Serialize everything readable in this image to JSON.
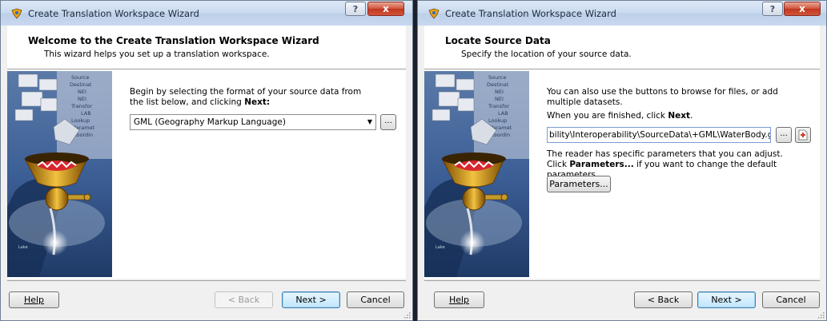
{
  "left_window": {
    "title": "Create Translation Workspace Wizard",
    "help_glyph": "?",
    "close_glyph": "x",
    "header_title": "Welcome to the Create Translation Workspace Wizard",
    "header_subtitle": "This wizard helps you set up a translation workspace.",
    "instruction_prefix": "Begin by selecting the format of your source data from the list below, and clicking ",
    "instruction_bold": "Next:",
    "format_select_value": "GML (Geography Markup Language)",
    "browse_label": "...",
    "buttons": {
      "help": "Help",
      "back": "< Back",
      "next": "Next >",
      "cancel": "Cancel"
    }
  },
  "right_window": {
    "title": "Create Translation Workspace Wizard",
    "help_glyph": "?",
    "close_glyph": "x",
    "header_title": "Locate Source Data",
    "header_subtitle": "Specify the location of your source data.",
    "browse_info": "You can also use the buttons to browse for files, or add multiple datasets.",
    "finish_prefix": "When you are finished, click ",
    "finish_bold": "Next",
    "finish_suffix": ".",
    "dataset_path": "bility\\Interoperability\\SourceData\\+GML\\WaterBody.gml\"",
    "browse_label": "...",
    "params_prefix": "The reader has specific parameters that you can adjust. Click ",
    "params_bold": "Parameters...",
    "params_suffix": " if you want to change the default parameters.",
    "parameters_button": "Parameters...",
    "buttons": {
      "help": "Help",
      "back": "< Back",
      "next": "Next >",
      "cancel": "Cancel"
    }
  },
  "illustration_labels": [
    "Source",
    "Destinat",
    "NEI",
    "NEI",
    "Transfor",
    "LAB",
    "Lookup",
    "Paramet",
    "Coordin"
  ],
  "colors": {
    "accent_default_button": "#3c7fb1",
    "close_button": "#c0371f",
    "titlebar": "#c9daef"
  }
}
